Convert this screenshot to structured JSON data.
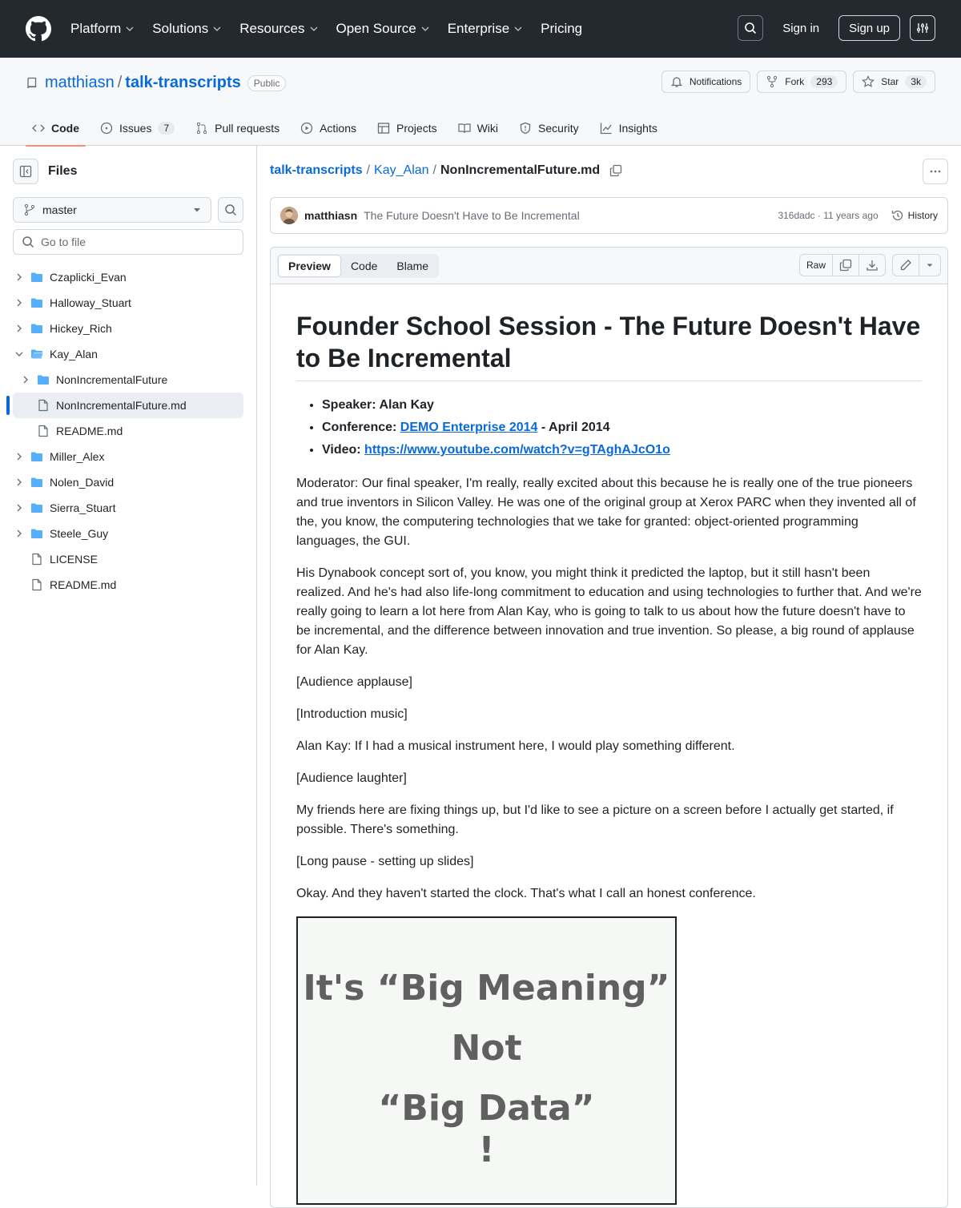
{
  "header": {
    "nav": [
      "Platform",
      "Solutions",
      "Resources",
      "Open Source",
      "Enterprise",
      "Pricing"
    ],
    "signin": "Sign in",
    "signup": "Sign up"
  },
  "repo": {
    "owner": "matthiasn",
    "name": "talk-transcripts",
    "visibility": "Public",
    "notifications": "Notifications",
    "fork_label": "Fork",
    "fork_count": "293",
    "star_label": "Star",
    "star_count": "3k"
  },
  "tabs": [
    {
      "label": "Code",
      "icon": "code-icon"
    },
    {
      "label": "Issues",
      "count": "7",
      "icon": "issue-icon"
    },
    {
      "label": "Pull requests",
      "icon": "pull-request-icon"
    },
    {
      "label": "Actions",
      "icon": "play-icon"
    },
    {
      "label": "Projects",
      "icon": "table-icon"
    },
    {
      "label": "Wiki",
      "icon": "book-icon"
    },
    {
      "label": "Security",
      "icon": "shield-icon"
    },
    {
      "label": "Insights",
      "icon": "graph-icon"
    }
  ],
  "sidebar": {
    "title": "Files",
    "branch": "master",
    "goto_placeholder": "Go to file",
    "tree": [
      {
        "name": "Czaplicki_Evan",
        "type": "dir",
        "depth": 0,
        "open": false
      },
      {
        "name": "Halloway_Stuart",
        "type": "dir",
        "depth": 0,
        "open": false
      },
      {
        "name": "Hickey_Rich",
        "type": "dir",
        "depth": 0,
        "open": false
      },
      {
        "name": "Kay_Alan",
        "type": "dir",
        "depth": 0,
        "open": true
      },
      {
        "name": "NonIncrementalFuture",
        "type": "dir",
        "depth": 1,
        "open": false
      },
      {
        "name": "NonIncrementalFuture.md",
        "type": "file",
        "depth": 1,
        "selected": true
      },
      {
        "name": "README.md",
        "type": "file",
        "depth": 1
      },
      {
        "name": "Miller_Alex",
        "type": "dir",
        "depth": 0,
        "open": false
      },
      {
        "name": "Nolen_David",
        "type": "dir",
        "depth": 0,
        "open": false
      },
      {
        "name": "Sierra_Stuart",
        "type": "dir",
        "depth": 0,
        "open": false
      },
      {
        "name": "Steele_Guy",
        "type": "dir",
        "depth": 0,
        "open": false
      },
      {
        "name": "LICENSE",
        "type": "file",
        "depth": 0
      },
      {
        "name": "README.md",
        "type": "file",
        "depth": 0
      }
    ]
  },
  "breadcrumb": {
    "repo": "talk-transcripts",
    "folder": "Kay_Alan",
    "file": "NonIncrementalFuture.md"
  },
  "commit": {
    "author": "matthiasn",
    "message": "The Future Doesn't Have to Be Incremental",
    "meta": "316dadc · 11 years ago",
    "history": "History"
  },
  "filebar": {
    "preview": "Preview",
    "code": "Code",
    "blame": "Blame",
    "raw": "Raw"
  },
  "article": {
    "title": "Founder School Session - The Future Doesn't Have to Be Incremental",
    "speaker": "Speaker: Alan Kay",
    "conference_label": "Conference: ",
    "conference_link": "DEMO Enterprise 2014",
    "conference_suffix": " - April 2014",
    "video_label": "Video: ",
    "video_link": "https://www.youtube.com/watch?v=gTAghAJcO1o",
    "paragraphs": [
      "Moderator: Our final speaker, I'm really, really excited about this because he is really one of the true pioneers and true inventors in Silicon Valley. He was one of the original group at Xerox PARC when they invented all of the, you know, the computering technologies that we take for granted: object-oriented programming languages, the GUI.",
      "His Dynabook concept sort of, you know, you might think it predicted the laptop, but it still hasn't been realized. And he's had also life-long commitment to education and using technologies to further that. And we're really going to learn a lot here from Alan Kay, who is going to talk to us about how the future doesn't have to be incremental, and the difference between innovation and true invention. So please, a big round of applause for Alan Kay.",
      "[Audience applause]",
      "[Introduction music]",
      "Alan Kay: If I had a musical instrument here, I would play something different.",
      "[Audience laughter]",
      "My friends here are fixing things up, but I'd like to see a picture on a screen before I actually get started, if possible. There's something.",
      "[Long pause - setting up slides]",
      "Okay. And they haven't started the clock. That's what I call an honest conference."
    ],
    "slide": [
      "It's “Big Meaning”",
      "Not",
      "“Big Data”",
      "!"
    ]
  }
}
